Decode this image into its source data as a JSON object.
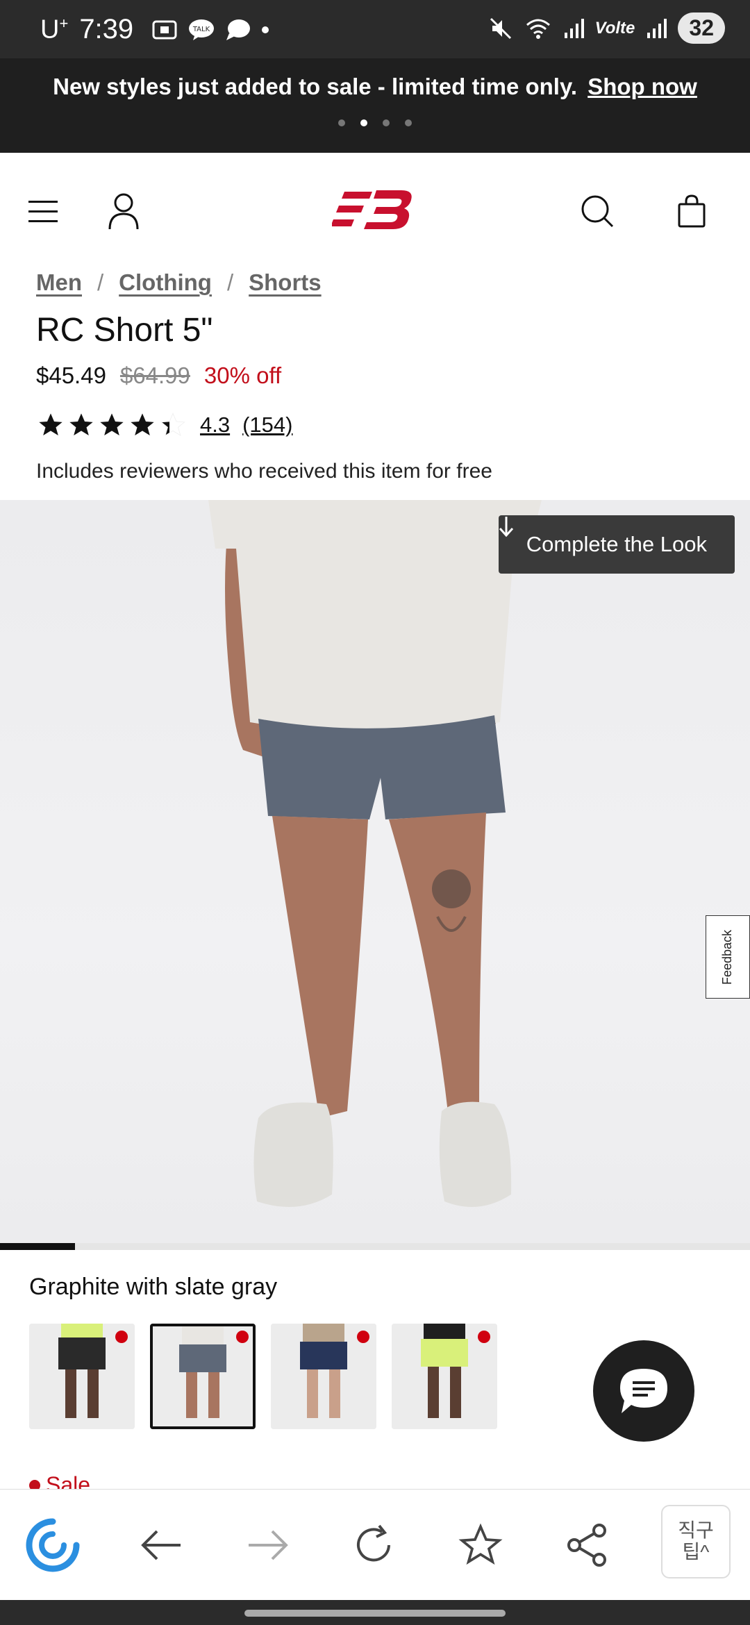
{
  "status_bar": {
    "carrier": "U",
    "carrier_sup": "+",
    "time": "7:39",
    "network_label": "Volte",
    "battery": "32"
  },
  "promo": {
    "text": "New styles just added to sale - limited time only.",
    "link": "Shop now",
    "slide_count": 4,
    "active_slide": 2
  },
  "breadcrumb": [
    "Men",
    "Clothing",
    "Shorts"
  ],
  "product": {
    "title": "RC Short 5\"",
    "price": "$45.49",
    "original_price": "$64.99",
    "discount": "30% off",
    "rating": "4.3",
    "review_count": "(154)",
    "reviewer_note": "Includes reviewers who received this item for free"
  },
  "gallery": {
    "complete_the_look": "Complete the Look",
    "progress_fraction": 0.1
  },
  "feedback_tab": "Feedback",
  "color": {
    "selected_name": "Graphite with slate gray",
    "swatches": [
      {
        "name": "black",
        "short": "#2a2a2a"
      },
      {
        "name": "graphite",
        "short": "#5e6878"
      },
      {
        "name": "navy",
        "short": "#28365a"
      },
      {
        "name": "lime",
        "short": "#d9f07a"
      }
    ],
    "selected_index": 1
  },
  "sale_label": "Sale",
  "browser_bar": {
    "tip_line1": "직구",
    "tip_line2": "팁^"
  },
  "colors": {
    "accent_red": "#c20e1a",
    "dark": "#1f1f1f"
  }
}
